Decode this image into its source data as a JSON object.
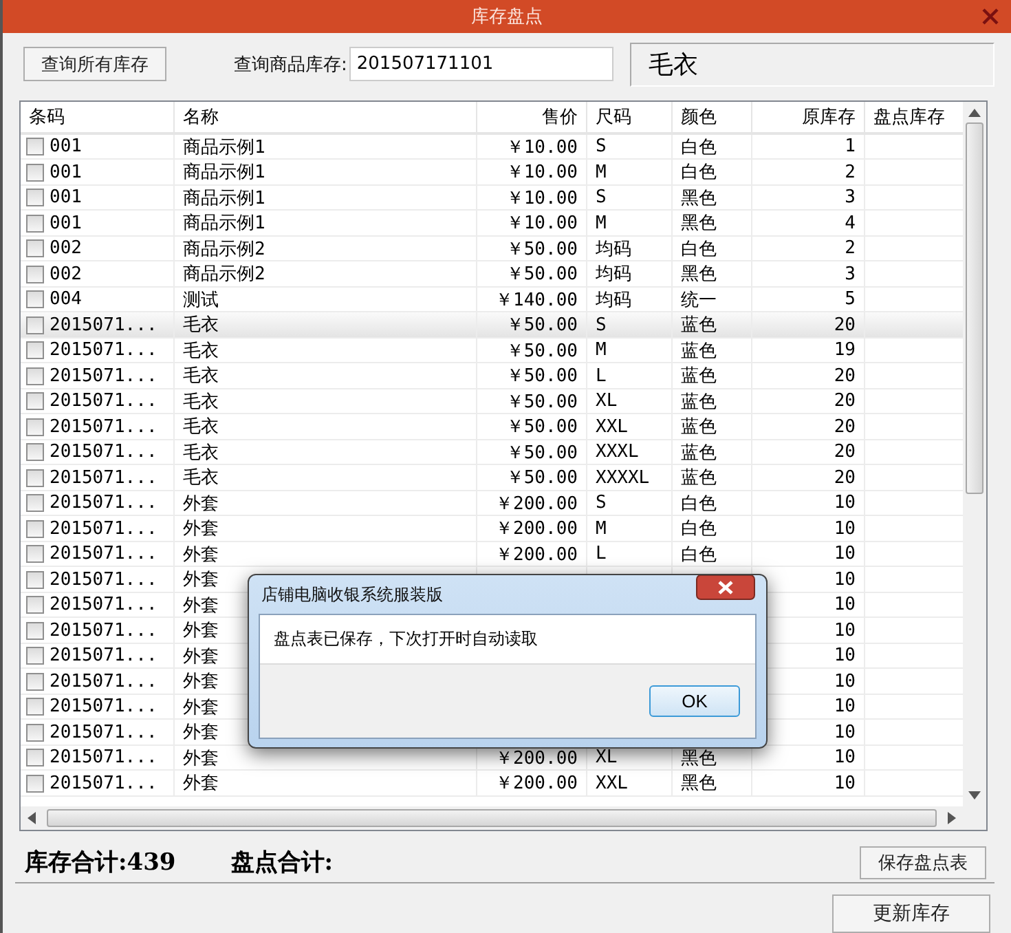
{
  "window": {
    "title": "库存盘点"
  },
  "toolbar": {
    "query_all_button": "查询所有库存",
    "query_label": "查询商品库存:",
    "query_value": "201507171101",
    "product_display": "毛衣"
  },
  "table": {
    "columns": [
      "条码",
      "名称",
      "售价",
      "尺码",
      "颜色",
      "原库存",
      "盘点库存"
    ],
    "rows": [
      {
        "checked": false,
        "selected": false,
        "barcode": "001",
        "name": "商品示例1",
        "price": "￥10.00",
        "size": "S",
        "color_name": "白色",
        "stock": "1"
      },
      {
        "checked": false,
        "selected": false,
        "barcode": "001",
        "name": "商品示例1",
        "price": "￥10.00",
        "size": "M",
        "color_name": "白色",
        "stock": "2"
      },
      {
        "checked": false,
        "selected": false,
        "barcode": "001",
        "name": "商品示例1",
        "price": "￥10.00",
        "size": "S",
        "color_name": "黑色",
        "stock": "3"
      },
      {
        "checked": false,
        "selected": false,
        "barcode": "001",
        "name": "商品示例1",
        "price": "￥10.00",
        "size": "M",
        "color_name": "黑色",
        "stock": "4"
      },
      {
        "checked": false,
        "selected": false,
        "barcode": "002",
        "name": "商品示例2",
        "price": "￥50.00",
        "size": "均码",
        "color_name": "白色",
        "stock": "2"
      },
      {
        "checked": false,
        "selected": false,
        "barcode": "002",
        "name": "商品示例2",
        "price": "￥50.00",
        "size": "均码",
        "color_name": "黑色",
        "stock": "3"
      },
      {
        "checked": false,
        "selected": false,
        "barcode": "004",
        "name": "测试",
        "price": "￥140.00",
        "size": "均码",
        "color_name": "统一",
        "stock": "5"
      },
      {
        "checked": false,
        "selected": true,
        "barcode": "2015071...",
        "name": "毛衣",
        "price": "￥50.00",
        "size": "S",
        "color_name": "蓝色",
        "stock": "20"
      },
      {
        "checked": false,
        "selected": false,
        "barcode": "2015071...",
        "name": "毛衣",
        "price": "￥50.00",
        "size": "M",
        "color_name": "蓝色",
        "stock": "19"
      },
      {
        "checked": false,
        "selected": false,
        "barcode": "2015071...",
        "name": "毛衣",
        "price": "￥50.00",
        "size": "L",
        "color_name": "蓝色",
        "stock": "20"
      },
      {
        "checked": false,
        "selected": false,
        "barcode": "2015071...",
        "name": "毛衣",
        "price": "￥50.00",
        "size": "XL",
        "color_name": "蓝色",
        "stock": "20"
      },
      {
        "checked": false,
        "selected": false,
        "barcode": "2015071...",
        "name": "毛衣",
        "price": "￥50.00",
        "size": "XXL",
        "color_name": "蓝色",
        "stock": "20"
      },
      {
        "checked": false,
        "selected": false,
        "barcode": "2015071...",
        "name": "毛衣",
        "price": "￥50.00",
        "size": "XXXL",
        "color_name": "蓝色",
        "stock": "20"
      },
      {
        "checked": false,
        "selected": false,
        "barcode": "2015071...",
        "name": "毛衣",
        "price": "￥50.00",
        "size": "XXXXL",
        "color_name": "蓝色",
        "stock": "20"
      },
      {
        "checked": false,
        "selected": false,
        "barcode": "2015071...",
        "name": "外套",
        "price": "￥200.00",
        "size": "S",
        "color_name": "白色",
        "stock": "10"
      },
      {
        "checked": false,
        "selected": false,
        "barcode": "2015071...",
        "name": "外套",
        "price": "￥200.00",
        "size": "M",
        "color_name": "白色",
        "stock": "10"
      },
      {
        "checked": false,
        "selected": false,
        "barcode": "2015071...",
        "name": "外套",
        "price": "￥200.00",
        "size": "L",
        "color_name": "白色",
        "stock": "10"
      },
      {
        "checked": false,
        "selected": false,
        "barcode": "2015071...",
        "name": "外套",
        "stock": "10"
      },
      {
        "checked": false,
        "selected": false,
        "barcode": "2015071...",
        "name": "外套",
        "stock": "10"
      },
      {
        "checked": false,
        "selected": false,
        "barcode": "2015071...",
        "name": "外套",
        "stock": "10"
      },
      {
        "checked": false,
        "selected": false,
        "barcode": "2015071...",
        "name": "外套",
        "stock": "10"
      },
      {
        "checked": false,
        "selected": false,
        "barcode": "2015071...",
        "name": "外套",
        "stock": "10"
      },
      {
        "checked": false,
        "selected": false,
        "barcode": "2015071...",
        "name": "外套",
        "stock": "10"
      },
      {
        "checked": false,
        "selected": false,
        "barcode": "2015071...",
        "name": "外套",
        "stock": "10"
      },
      {
        "checked": false,
        "selected": false,
        "barcode": "2015071...",
        "name": "外套",
        "price": "￥200.00",
        "size": "XL",
        "color_name": "黑色",
        "stock": "10"
      },
      {
        "checked": false,
        "selected": false,
        "barcode": "2015071...",
        "name": "外套",
        "price": "￥200.00",
        "size": "XXL",
        "color_name": "黑色",
        "stock": "10"
      }
    ]
  },
  "summary": {
    "stock_total": "库存合计:439",
    "count_total": "盘点合计:",
    "save_button": "保存盘点表"
  },
  "update_button": "更新库存",
  "dialog": {
    "title": "店铺电脑收银系统服装版",
    "message": "盘点表已保存，下次打开时自动读取",
    "ok_button": "OK"
  }
}
